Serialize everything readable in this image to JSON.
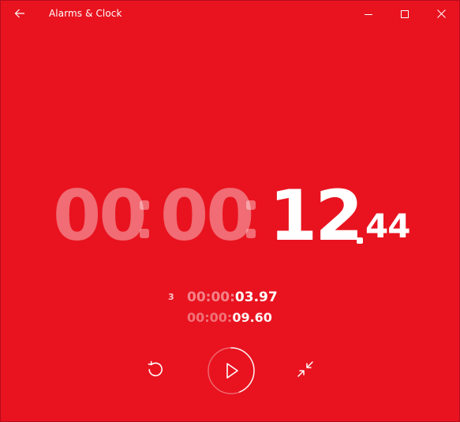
{
  "app": {
    "title": "Alarms & Clock",
    "background_color": "#e8131f"
  },
  "titlebar": {
    "back_icon": "arrow-left-icon",
    "minimize_icon": "minimize-icon",
    "maximize_icon": "maximize-icon",
    "close_icon": "close-icon"
  },
  "stopwatch": {
    "hours": "00",
    "minutes": "00",
    "seconds": "12",
    "hundredths": "44"
  },
  "laps": {
    "current_lap_number": "3",
    "current_lap_dim": "00:00:",
    "current_lap_value": "03.97",
    "total_dim": "00:00:",
    "total_value": "09.60"
  },
  "controls": {
    "reset_icon": "reset-icon",
    "play_icon": "play-icon",
    "compact_icon": "compact-overlay-icon",
    "progress_fraction": 0.44
  }
}
